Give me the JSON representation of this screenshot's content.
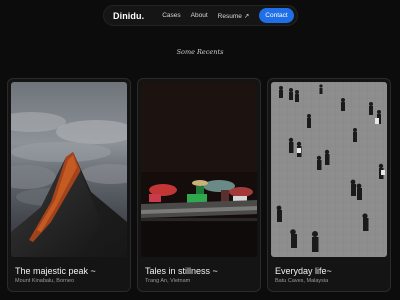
{
  "nav": {
    "brand": "Dinidu.",
    "links": [
      "Cases",
      "About",
      "Resume"
    ],
    "resume_arrow": "↗",
    "contact_label": "Contact"
  },
  "section_label": "Some Recents",
  "cards": [
    {
      "title": "The majestic peak ~",
      "subtitle": "Mount Kinabalu, Borneo"
    },
    {
      "title": "Tales in stillness ~",
      "subtitle": "Trang An, Vietnam"
    },
    {
      "title": "Everyday life~",
      "subtitle": "Batu Caves, Malaysia"
    }
  ],
  "colors": {
    "background": "#0c0c0c",
    "accent": "#1f6fe8",
    "card": "#141414"
  }
}
